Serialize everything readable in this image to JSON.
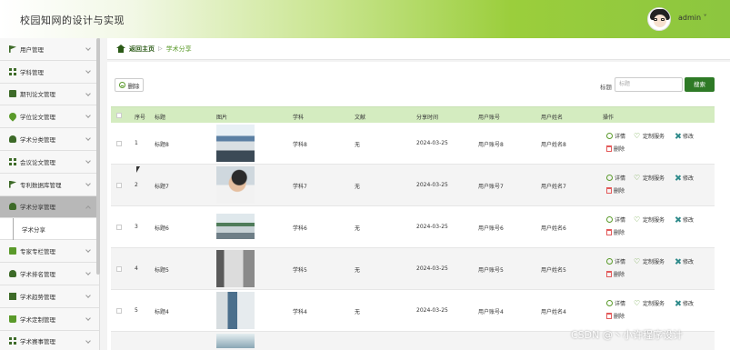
{
  "header": {
    "title": "校园知网的设计与实现",
    "user": "admin"
  },
  "sidebar": {
    "items": [
      {
        "label": "用户管理"
      },
      {
        "label": "学科管理"
      },
      {
        "label": "期刊论文管理"
      },
      {
        "label": "学位论文管理"
      },
      {
        "label": "学术分类管理"
      },
      {
        "label": "会议论文管理"
      },
      {
        "label": "专利数据库管理"
      },
      {
        "label": "学术分享管理"
      },
      {
        "label": "专家专栏管理"
      },
      {
        "label": "学术排名管理"
      },
      {
        "label": "学术趋势管理"
      },
      {
        "label": "学术定制管理"
      },
      {
        "label": "学术赛事管理"
      }
    ],
    "subitem": "学术分享"
  },
  "breadcrumb": {
    "home": "返回主页",
    "current": "学术分享"
  },
  "toolbar": {
    "delete_label": "删除",
    "search_label": "标题",
    "search_placeholder": "标题",
    "search_button": "搜索"
  },
  "table": {
    "headers": [
      "序号",
      "标题",
      "图片",
      "学科",
      "文献",
      "分享时间",
      "用户账号",
      "用户姓名",
      "操作"
    ],
    "rows": [
      {
        "idx": "1",
        "title": "标题8",
        "subject": "学科8",
        "doc": "无",
        "time": "2024-03-25",
        "account": "用户账号8",
        "name": "用户姓名8"
      },
      {
        "idx": "2",
        "title": "标题7",
        "subject": "学科7",
        "doc": "无",
        "time": "2024-03-25",
        "account": "用户账号7",
        "name": "用户姓名7"
      },
      {
        "idx": "3",
        "title": "标题6",
        "subject": "学科6",
        "doc": "无",
        "time": "2024-03-25",
        "account": "用户账号6",
        "name": "用户姓名6"
      },
      {
        "idx": "4",
        "title": "标题5",
        "subject": "学科5",
        "doc": "无",
        "time": "2024-03-25",
        "account": "用户账号5",
        "name": "用户姓名5"
      },
      {
        "idx": "5",
        "title": "标题4",
        "subject": "学科4",
        "doc": "无",
        "time": "2024-03-25",
        "account": "用户账号4",
        "name": "用户姓名4"
      }
    ],
    "actions": {
      "detail": "详情",
      "custom": "定制服务",
      "edit": "修改",
      "delete": "删除"
    }
  },
  "watermark": "CSDN @丶小许程序设计"
}
